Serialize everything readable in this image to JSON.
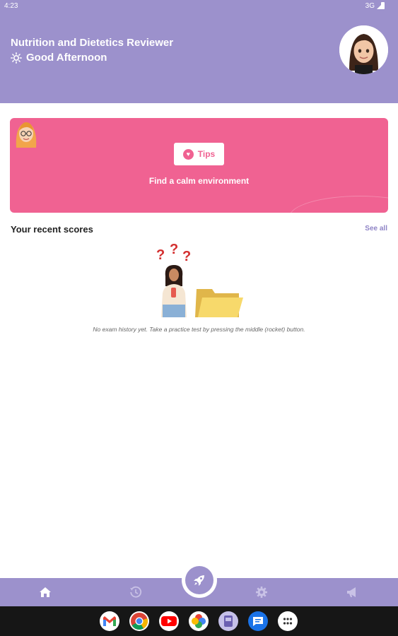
{
  "status_bar": {
    "time": "4:23",
    "network": "3G"
  },
  "header": {
    "app_title": "Nutrition and Dietetics Reviewer",
    "greeting": "Good Afternoon",
    "greeting_icon": "sun-icon"
  },
  "tip_card": {
    "button_label": "Tips",
    "tip_text": "Find a calm environment",
    "color": "#f06292"
  },
  "recent_scores": {
    "title": "Your recent scores",
    "see_all": "See all",
    "empty_message": "No exam history yet. Take a practice test by pressing the middle (rocket) button."
  },
  "bottom_nav": {
    "items": [
      "home-icon",
      "history-icon",
      "rocket-icon",
      "settings-icon",
      "megaphone-icon"
    ],
    "color": "#9c91cc"
  },
  "dock": {
    "apps": [
      "gmail-icon",
      "chrome-icon",
      "youtube-icon",
      "photos-icon",
      "files-icon",
      "messages-icon",
      "app-drawer-icon"
    ]
  }
}
